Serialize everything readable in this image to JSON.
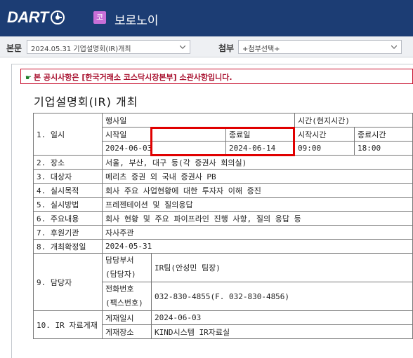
{
  "header": {
    "logo_text": "DART",
    "corp_badge": "코",
    "corp_name": "보로노이"
  },
  "selectbar": {
    "main_label": "본문",
    "main_value": "2024.05.31  기업설명회(IR)개최",
    "attach_label": "첨부",
    "attach_value": "+첨부선택+"
  },
  "notice": "본 공시사항은 [한국거래소 코스닥시장본부] 소관사항입니다.",
  "doc": {
    "title": "기업설명회(IR) 개최",
    "h_event_date": "행사일",
    "h_time": "시간(현지시간)",
    "r1_label": "1. 일시",
    "h_start_date": "시작일",
    "h_end_date": "종료일",
    "h_start_time": "시작시간",
    "h_end_time": "종료시간",
    "start_date": "2024-06-03",
    "end_date": "2024-06-14",
    "start_time": "09:00",
    "end_time": "18:00",
    "r2_label": "2. 장소",
    "r2_value": "서울, 부산, 대구 등(각 증권사 회의실)",
    "r3_label": "3. 대상자",
    "r3_value": "메리츠 증권 외 국내 증권사 PB",
    "r4_label": "4. 실시목적",
    "r4_value": "회사 주요 사업현황에 대한 투자자 이해 증진",
    "r5_label": "5. 실시방법",
    "r5_value": "프레젠테이션 및 질의응답",
    "r6_label": "6. 주요내용",
    "r6_value": "회사 현황 및 주요 파이프라인 진행 사항, 질의 응답 등",
    "r7_label": "7. 후원기관",
    "r7_value": "자사주관",
    "r8_label": "8. 개최확정일",
    "r8_value": "2024-05-31",
    "r9_label": "9. 담당자",
    "r9_dept_label_1": "담당부서",
    "r9_dept_label_2": "(담당자)",
    "r9_dept_value": "IR팀(안성민 팀장)",
    "r9_phone_label_1": "전화번호",
    "r9_phone_label_2": "(팩스번호)",
    "r9_phone_value": "032-830-4855(F. 032-830-4856)",
    "r10_label": "10. IR 자료게재",
    "r10_date_label": "게재일시",
    "r10_date_value": "2024-06-03",
    "r10_place_label": "게재장소",
    "r10_place_value": "KIND시스템 IR자료실"
  },
  "colors": {
    "topbar": "#1c3d74",
    "badge": "#c86fd7",
    "notice_border": "#c8102e",
    "highlight": "#e00000"
  },
  "icons": {
    "logo": "dart-logo-mark",
    "notice": "pointing-hand-icon",
    "select_arrow": "chevron-down-icon"
  }
}
